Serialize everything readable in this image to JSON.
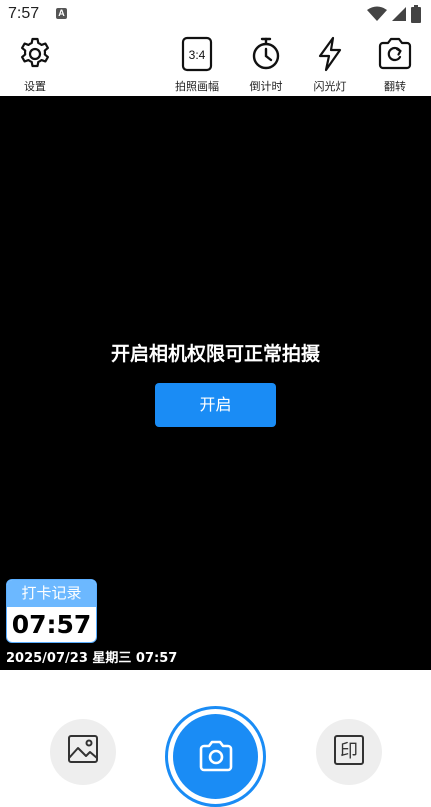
{
  "status_bar": {
    "time": "7:57",
    "notification_glyph": "A"
  },
  "toolbar": {
    "settings_label": "设置",
    "aspect_label": "拍照画幅",
    "aspect_value": "3:4",
    "timer_label": "倒计时",
    "flash_label": "闪光灯",
    "flip_label": "翻转"
  },
  "camera": {
    "permission_message": "开启相机权限可正常拍摄",
    "enable_button": "开启"
  },
  "checkin": {
    "title": "打卡记录",
    "time": "07:57",
    "datetime": "2025/07/23 星期三 07:57"
  },
  "bottom": {
    "print_glyph": "印"
  },
  "colors": {
    "accent": "#1a8cf5",
    "checkin_header": "#6cb8ff",
    "viewfinder": "#000000"
  }
}
